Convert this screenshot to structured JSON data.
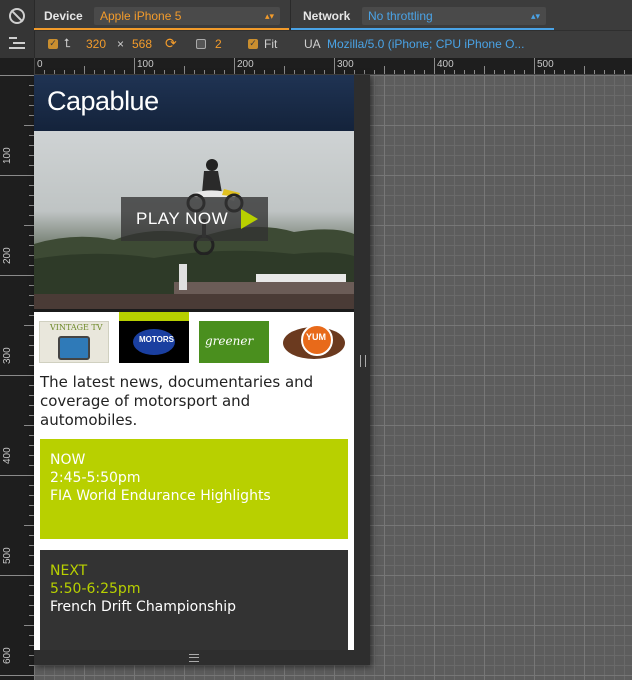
{
  "toolbar": {
    "device_label": "Device",
    "device_value": "Apple iPhone 5",
    "network_label": "Network",
    "network_value": "No throttling",
    "width": "320",
    "times": "×",
    "height": "568",
    "scale": "2",
    "fit_label": "Fit",
    "ua_label": "UA",
    "ua_value": "Mozilla/5.0 (iPhone; CPU iPhone O...",
    "colors": {
      "accent_orange": "#f29b2b",
      "accent_blue": "#4aa3e6"
    }
  },
  "ruler": {
    "top_labels": [
      "0",
      "100",
      "200",
      "300",
      "400",
      "500"
    ],
    "left_labels": [
      "100",
      "200",
      "300",
      "400",
      "500",
      "600"
    ]
  },
  "page": {
    "logo": "Capablue",
    "play_label": "PLAY NOW",
    "channels": [
      "Vintage TV",
      "Motors TV",
      "greener TV",
      "YUM TV"
    ],
    "channel_texts": {
      "vintage": "VINTAGE TV",
      "motors": "MOTORS",
      "greener": "greener",
      "yum": "YUM"
    },
    "tagline": "The latest news, documentaries and coverage of motorsport and automobiles.",
    "now": {
      "label": "NOW",
      "time": "2:45-5:50pm",
      "title": "FIA World Endurance Highlights"
    },
    "next": {
      "label": "NEXT",
      "time": "5:50-6:25pm",
      "title": "French Drift Championship"
    },
    "colors": {
      "header": "#1f3353",
      "green": "#b8d000",
      "dark_card": "#333333"
    }
  }
}
